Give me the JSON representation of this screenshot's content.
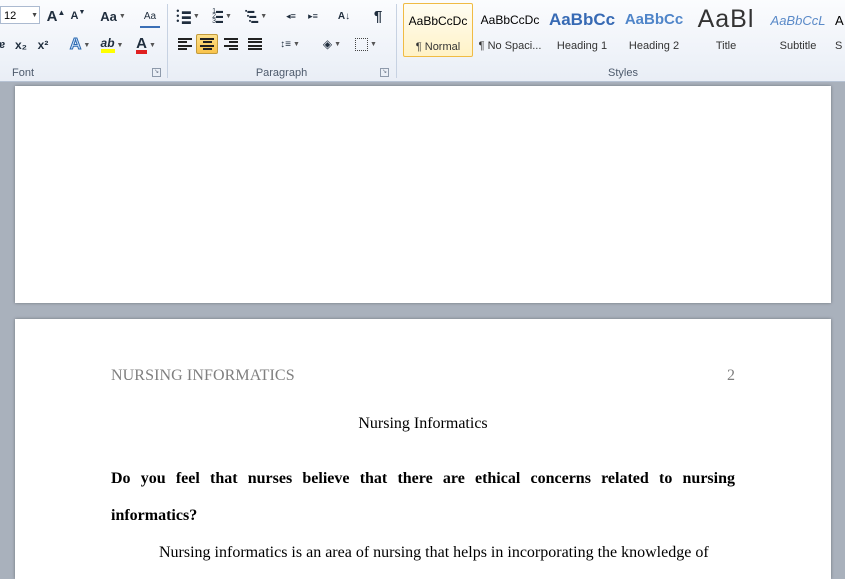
{
  "ribbon": {
    "font": {
      "label": "Font",
      "size": "12",
      "grow_icon": "A",
      "shrink_icon": "A",
      "change_case": "Aa",
      "subscript": "x₂",
      "superscript": "x²",
      "strike": "ɐ",
      "text_effects": "A",
      "font_color": "A",
      "highlight": "ab",
      "clear_format": "Aa"
    },
    "paragraph": {
      "label": "Paragraph",
      "pilcrow": "¶",
      "sort": "A↓"
    },
    "styles": {
      "label": "Styles",
      "items": [
        {
          "sample": "AaBbCcDc",
          "name": "¶ Normal"
        },
        {
          "sample": "AaBbCcDc",
          "name": "¶ No Spaci..."
        },
        {
          "sample": "AaBbCc",
          "name": "Heading 1"
        },
        {
          "sample": "AaBbCc",
          "name": "Heading 2"
        },
        {
          "sample": "AaBl",
          "name": "Title"
        },
        {
          "sample": "AaBbCcL",
          "name": "Subtitle"
        },
        {
          "sample": "A",
          "name": "S"
        }
      ]
    },
    "colors": {
      "highlight": "#ffff00",
      "font_color": "#e02020",
      "accent": "#2b579a"
    }
  },
  "document": {
    "header_text": "NURSING INFORMATICS",
    "page_number": "2",
    "title": "Nursing Informatics",
    "question": "Do you feel that nurses believe that there are ethical concerns related to nursing informatics?",
    "paragraph": "Nursing informatics is an area of nursing that helps in incorporating the knowledge of"
  }
}
